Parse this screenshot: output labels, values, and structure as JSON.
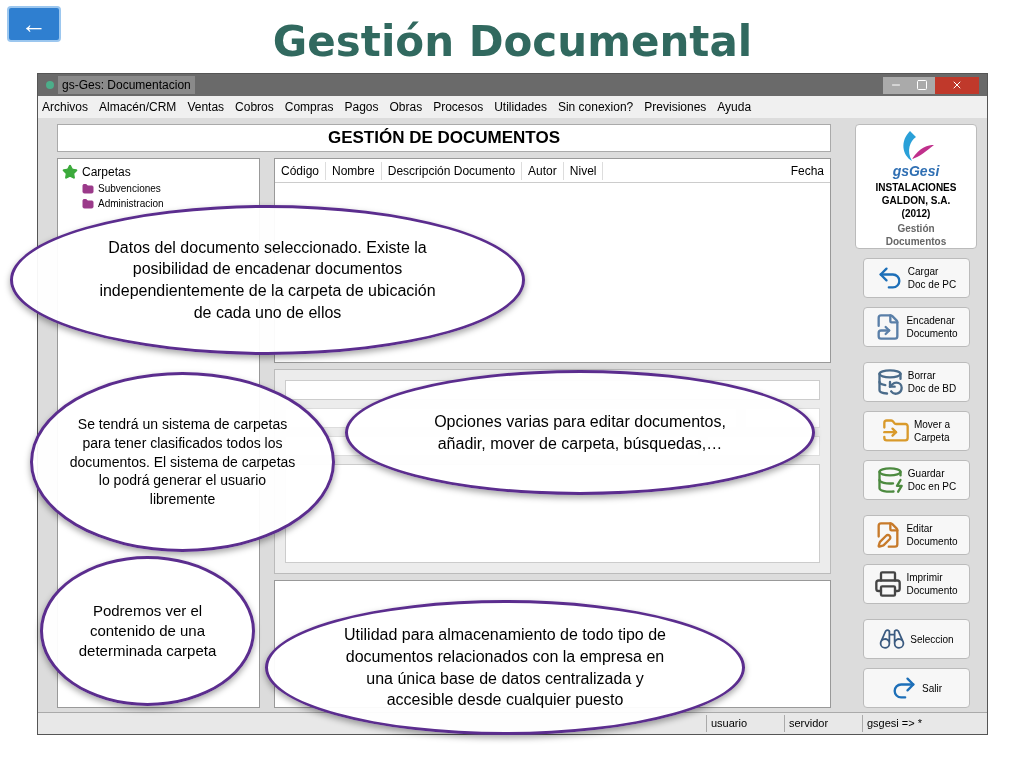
{
  "slide": {
    "back_button": "←",
    "title": "Gestión Documental"
  },
  "window": {
    "title": "gs-Ges: Documentacion",
    "menu": [
      "Archivos",
      "Almacén/CRM",
      "Ventas",
      "Cobros",
      "Compras",
      "Pagos",
      "Obras",
      "Procesos",
      "Utilidades",
      "Sin conexion?",
      "Previsiones",
      "Ayuda"
    ],
    "header": "GESTIÓN DE DOCUMENTOS",
    "tree": {
      "label": "Carpetas",
      "children": [
        {
          "label": "Subvenciones"
        },
        {
          "label": "Administracion"
        }
      ]
    },
    "table": {
      "columns": [
        "Código",
        "Nombre",
        "Descripción Documento",
        "Autor",
        "Nivel",
        "Fecha"
      ]
    },
    "logo": {
      "name": "gsGesi",
      "company": "INSTALACIONES GALDON, S.A. (2012)",
      "subtitle": "Gestión Documentos"
    },
    "actions": [
      {
        "kind": "load",
        "label": "Cargar\nDoc de PC"
      },
      {
        "kind": "chain",
        "label": "Encadenar\nDocumento"
      },
      {
        "kind": "delete",
        "label": "Borrar\nDoc de BD"
      },
      {
        "kind": "move",
        "label": "Mover a\nCarpeta"
      },
      {
        "kind": "save",
        "label": "Guardar\nDoc en PC"
      },
      {
        "kind": "edit",
        "label": "Editar\nDocumento"
      },
      {
        "kind": "print",
        "label": "Imprimir\nDocumento"
      },
      {
        "kind": "select",
        "label": "Seleccion"
      },
      {
        "kind": "exit",
        "label": "Salir"
      }
    ],
    "status_bar": [
      "usuario",
      "servidor",
      "gsgesi => *"
    ]
  },
  "callouts": [
    {
      "text": "Datos del documento seleccionado. Existe la posibilidad de encadenar documentos independientemente de la carpeta de ubicación de cada uno de ellos"
    },
    {
      "text": "Se tendrá un sistema de carpetas para tener clasificados todos los documentos. El sistema de carpetas lo podrá generar el usuario libremente"
    },
    {
      "text": "Podremos ver el contenido de una determinada carpeta"
    },
    {
      "text": "Opciones varias para editar documentos, añadir, mover de carpeta, búsquedas,…"
    },
    {
      "text": "Utilidad para almacenamiento de todo tipo de documentos relacionados con la empresa en una única base de datos centralizada y accesible desde cualquier puesto"
    }
  ]
}
